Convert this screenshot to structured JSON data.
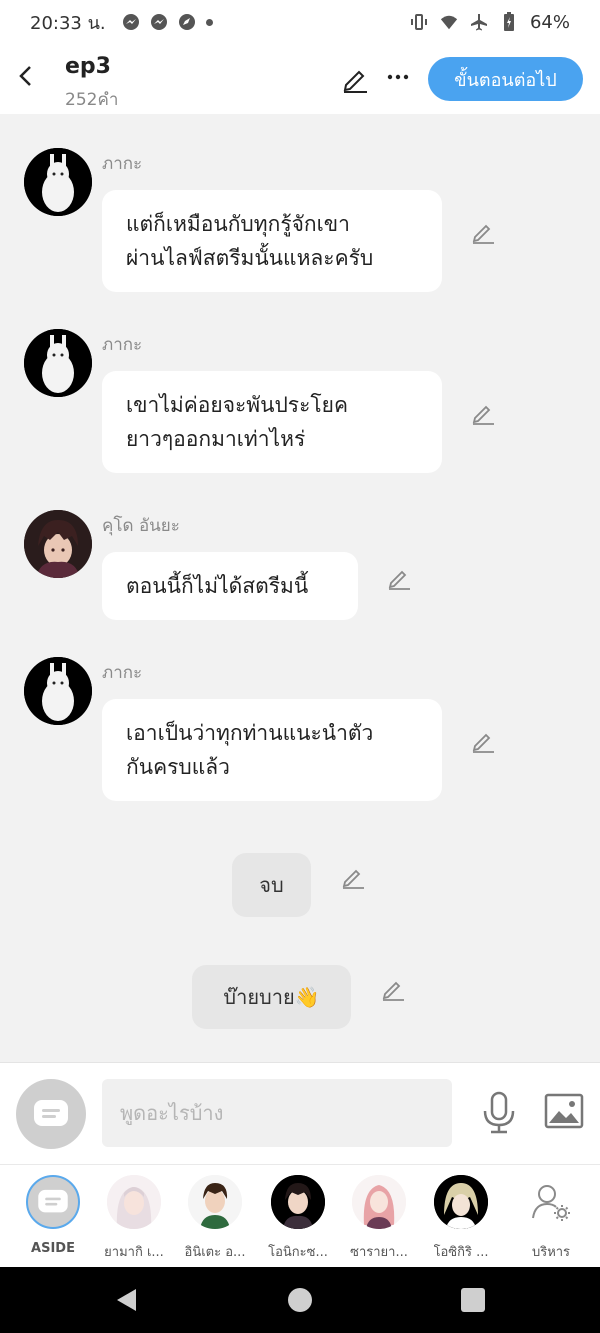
{
  "status_bar": {
    "time": "20:33 น.",
    "battery": "64%"
  },
  "header": {
    "title": "ep3",
    "subtitle": "252คำ",
    "next_button": "ขั้นตอนต่อไป"
  },
  "messages": [
    {
      "sender": "ภากะ",
      "text": "แต่ก็เหมือนกับทุกรู้จักเขา\nผ่านไลฟ์สตรีมนั้นแหละครับ"
    },
    {
      "sender": "ภากะ",
      "text": "เขาไม่ค่อยจะพันประโยค\nยาวๆออกมาเท่าไหร่"
    },
    {
      "sender": "คุโด อันยะ",
      "text": "ตอนนี้ก็ไม่ได้สตรีมนี้"
    },
    {
      "sender": "ภากะ",
      "text": "เอาเป็นว่าทุกท่านแนะนำตัว\nกันครบแล้ว"
    }
  ],
  "narrations": [
    {
      "text": "จบ"
    },
    {
      "text": "บ๊ายบาย👋"
    }
  ],
  "input": {
    "placeholder": "พูดอะไรบ้าง"
  },
  "characters": [
    {
      "name": "ASIDE"
    },
    {
      "name": "ยามากิ เ..."
    },
    {
      "name": "อินิเตะ อ..."
    },
    {
      "name": "โอนิกะซ..."
    },
    {
      "name": "ซารายา..."
    },
    {
      "name": "โอซิกิริ ..."
    },
    {
      "name": "บริหาร"
    }
  ],
  "colors": {
    "accent": "#4aa3f0",
    "background": "#f2f2f2"
  }
}
